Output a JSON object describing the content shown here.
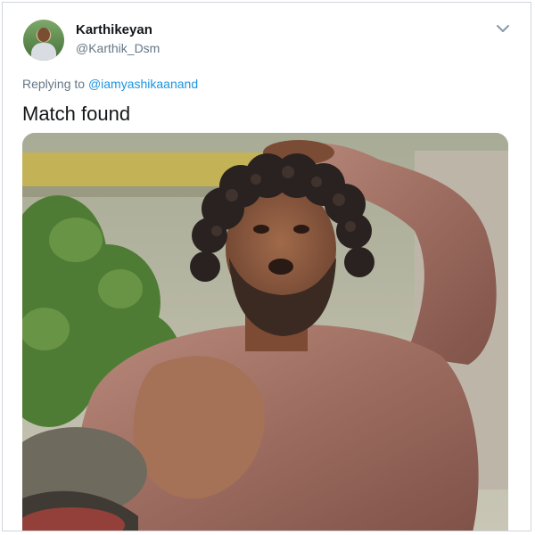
{
  "tweet": {
    "author_name": "Karthikeyan",
    "author_handle": "@Karthik_Dsm",
    "reply_prefix": "Replying to",
    "reply_mention": "@iamyashikaanand",
    "text": "Match found"
  },
  "icons": {
    "menu": "chevron-down-icon"
  },
  "media": {
    "description_kind": "photo"
  },
  "colors": {
    "text_primary": "#14171a",
    "text_secondary": "#657786",
    "link": "#1b95e0",
    "border": "#cfd6dc"
  }
}
